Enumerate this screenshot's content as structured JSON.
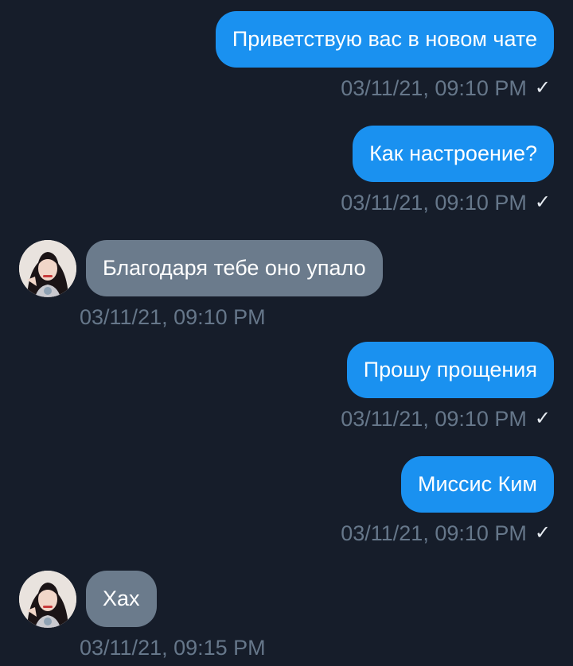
{
  "messages": [
    {
      "direction": "out",
      "text": "Приветствую вас в новом чате",
      "time": "03/11/21, 09:10 PM",
      "status_icon": "✓"
    },
    {
      "direction": "out",
      "text": "Как настроение?",
      "time": "03/11/21, 09:10 PM",
      "status_icon": "✓"
    },
    {
      "direction": "in",
      "text": "Благодаря тебе оно упало",
      "time": "03/11/21, 09:10 PM",
      "avatar_icon": "user-avatar-icon"
    },
    {
      "direction": "out",
      "text": "Прошу прощения",
      "time": "03/11/21, 09:10 PM",
      "status_icon": "✓"
    },
    {
      "direction": "out",
      "text": "Миссис Ким",
      "time": "03/11/21, 09:10 PM",
      "status_icon": "✓"
    },
    {
      "direction": "in",
      "text": "Хах",
      "time": "03/11/21, 09:15 PM",
      "avatar_icon": "user-avatar-icon"
    }
  ],
  "colors": {
    "background": "#161d2a",
    "outgoing_bubble": "#1a91f0",
    "incoming_bubble": "#6b7b8c",
    "timestamp": "#66778a",
    "check": "#e6ebf1"
  }
}
